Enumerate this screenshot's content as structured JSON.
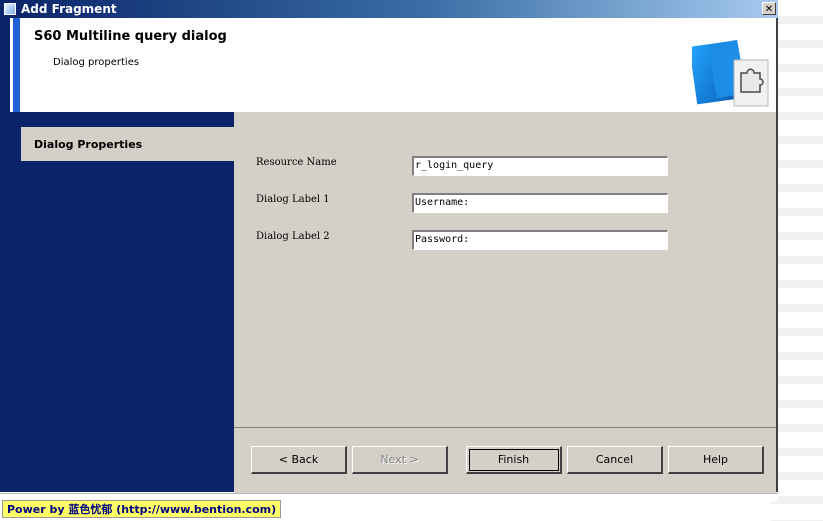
{
  "window": {
    "title": "Add Fragment",
    "close_glyph": "✕"
  },
  "header": {
    "title": "S60 Multiline query dialog",
    "subtitle": "Dialog properties",
    "art_icon": "puzzle-piece-wizard-icon"
  },
  "sidebar": {
    "active_item": "Dialog Properties"
  },
  "form": {
    "resource_name": {
      "label": "Resource Name",
      "value": "r_login_query"
    },
    "dialog_label_1": {
      "label": "Dialog Label 1",
      "value": "Username:"
    },
    "dialog_label_2": {
      "label": "Dialog Label 2",
      "value": "Password:"
    }
  },
  "buttons": {
    "back": "< Back",
    "next": "Next >",
    "finish": "Finish",
    "cancel": "Cancel",
    "help": "Help"
  },
  "watermark": {
    "text": "Power by 蓝色忧郁 (http://www.bention.com)"
  },
  "colors": {
    "navy": "#0a246a",
    "accent_blue": "#1f63d8",
    "dialog_gray": "#d4d0c8",
    "watermark_yellow": "#ffff66"
  }
}
